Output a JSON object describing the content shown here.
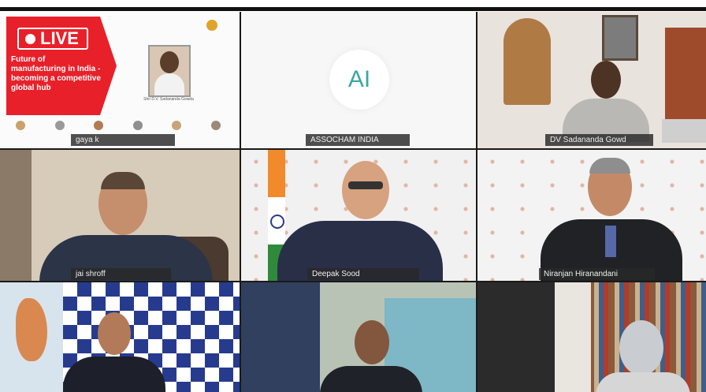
{
  "meeting": {
    "tiles": [
      {
        "name": "gaya k"
      },
      {
        "name": "ASSOCHAM INDIA",
        "avatar_text": "AI"
      },
      {
        "name": "DV Sadananda Gowd"
      },
      {
        "name": "jai shroff"
      },
      {
        "name": "Deepak Sood"
      },
      {
        "name": "Niranjan Hiranandani"
      },
      {
        "name": ""
      },
      {
        "name": ""
      },
      {
        "name": ""
      }
    ]
  },
  "slide": {
    "live_label": "LIVE",
    "title": "Future of manufacturing in India - becoming a competitive global hub",
    "speaker": "Shri D.V. Sadananda Gowda"
  },
  "colors": {
    "accent_red": "#e8202a",
    "nametag_bg": "#282828"
  }
}
